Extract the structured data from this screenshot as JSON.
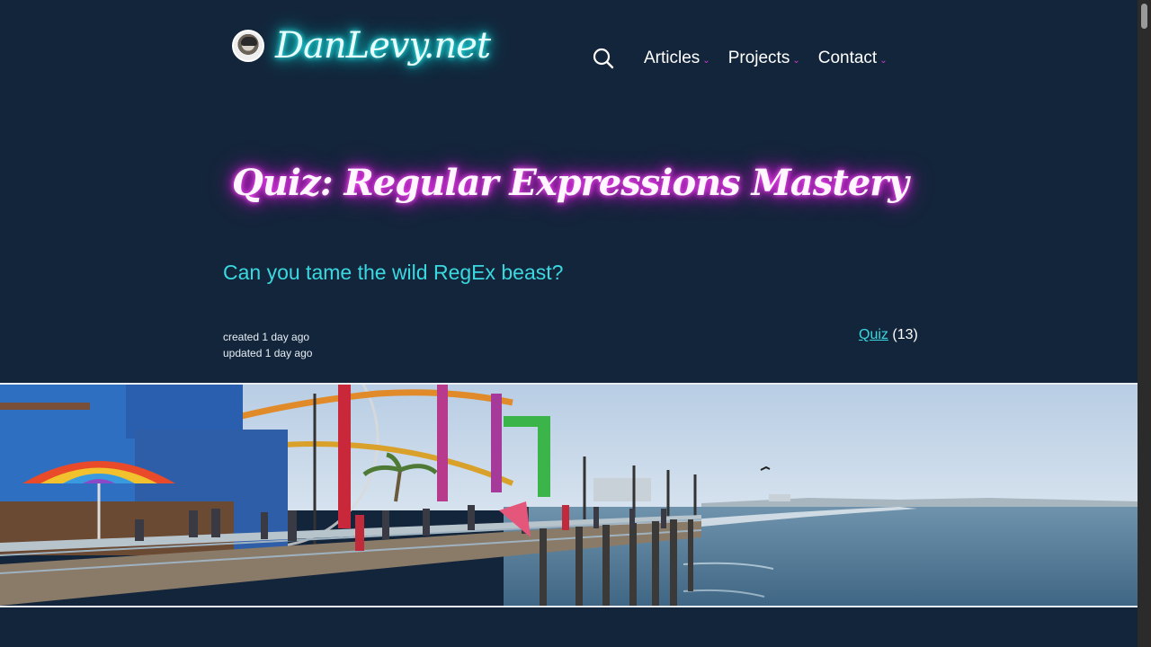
{
  "header": {
    "site_name": "DanLevy.net",
    "avatar_icon": "avatar-photo"
  },
  "nav": {
    "search_icon": "search-icon",
    "items": [
      {
        "label": "Articles"
      },
      {
        "label": "Projects"
      },
      {
        "label": "Contact"
      }
    ],
    "chevron": "⌄"
  },
  "article": {
    "title": "Quiz: Regular Expressions Mastery",
    "subtitle": "Can you tame the wild RegEx beast?",
    "created": "created 1 day ago",
    "updated": "updated 1 day ago",
    "tag": {
      "label": "Quiz",
      "count": "(13)"
    }
  },
  "hero": {
    "description_icon": "santa-monica-pier-photo"
  },
  "colors": {
    "background": "#13253a",
    "accent_cyan": "#3ad8e0",
    "accent_magenta": "#d33bd3"
  }
}
